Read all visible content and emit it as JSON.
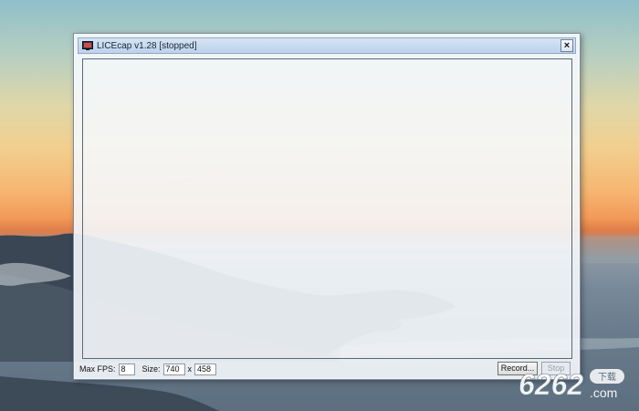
{
  "window": {
    "title": "LICEcap v1.28 [stopped]",
    "close_label": "×"
  },
  "controls": {
    "max_fps_label": "Max FPS:",
    "max_fps_value": "8",
    "size_label": "Size:",
    "width_value": "740",
    "size_separator": "x",
    "height_value": "458",
    "record_label": "Record...",
    "stop_label": "Stop"
  },
  "icons": {
    "app": "licecap-app-icon",
    "close": "close-icon"
  },
  "watermark": {
    "brand": "6262",
    "tag": "下载",
    "suffix": ".com"
  },
  "colors": {
    "titlebar": "#bcd2ec",
    "window_frame": "#f5f8fc"
  }
}
